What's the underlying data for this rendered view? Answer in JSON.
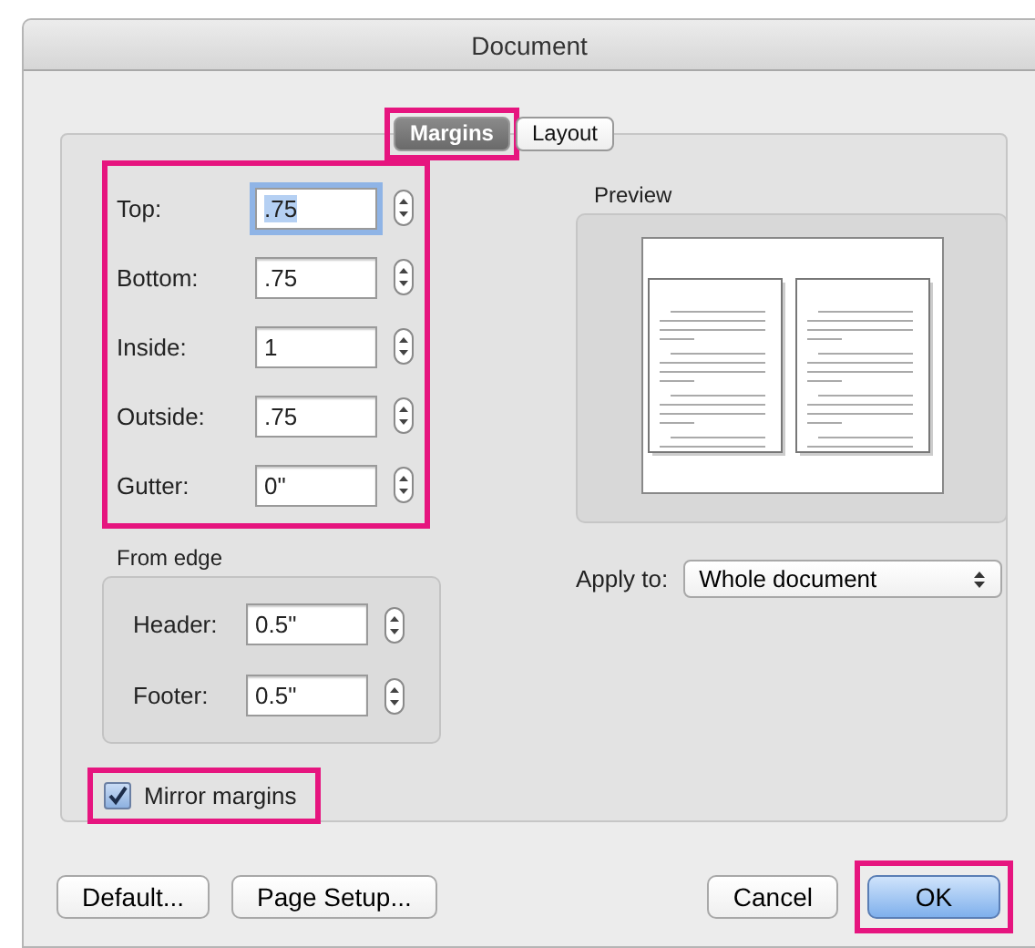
{
  "window": {
    "title": "Document"
  },
  "tabs": [
    {
      "label": "Margins",
      "selected": true,
      "highlighted": true
    },
    {
      "label": "Layout",
      "selected": false,
      "highlighted": false
    }
  ],
  "margins": {
    "highlighted": true,
    "fields": [
      {
        "label": "Top:",
        "value": ".75",
        "focused": true
      },
      {
        "label": "Bottom:",
        "value": ".75",
        "focused": false
      },
      {
        "label": "Inside:",
        "value": "1",
        "focused": false
      },
      {
        "label": "Outside:",
        "value": ".75",
        "focused": false
      },
      {
        "label": "Gutter:",
        "value": "0\"",
        "focused": false
      }
    ]
  },
  "preview": {
    "label": "Preview"
  },
  "apply_to": {
    "label": "Apply to:",
    "value": "Whole document"
  },
  "from_edge": {
    "title": "From edge",
    "fields": [
      {
        "label": "Header:",
        "value": "0.5\"",
        "focused": false
      },
      {
        "label": "Footer:",
        "value": "0.5\"",
        "focused": false
      }
    ]
  },
  "mirror_margins": {
    "label": "Mirror margins",
    "checked": true,
    "highlighted": true
  },
  "buttons": [
    {
      "label": "Default...",
      "kind": "normal",
      "highlighted": false
    },
    {
      "label": "Page Setup...",
      "kind": "normal",
      "highlighted": false
    },
    {
      "label": "Cancel",
      "kind": "normal",
      "highlighted": false
    },
    {
      "label": "OK",
      "kind": "default",
      "highlighted": true
    }
  ]
}
